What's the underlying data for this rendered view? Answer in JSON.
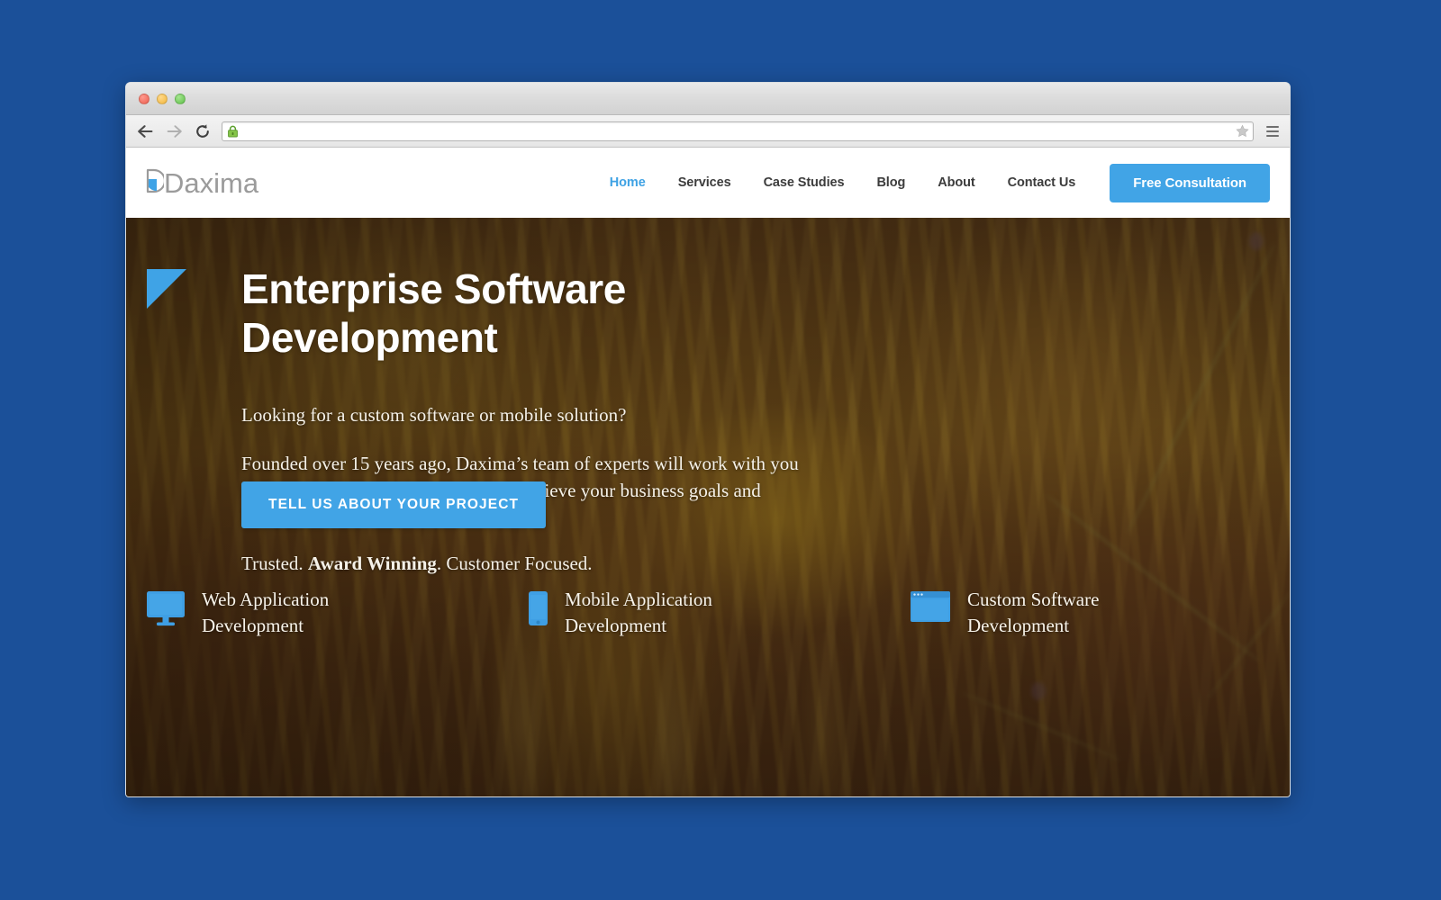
{
  "desktop": {
    "background_color": "#1b5099"
  },
  "browser": {
    "window_controls": [
      {
        "name": "close",
        "color": "#ec5f4f"
      },
      {
        "name": "minimize",
        "color": "#f1b63c"
      },
      {
        "name": "zoom",
        "color": "#5fbf4a"
      }
    ],
    "toolbar": {
      "back_icon": "back-arrow-icon",
      "forward_icon": "forward-arrow-icon",
      "reload_icon": "reload-icon",
      "lock_icon": "green-padlock-icon",
      "star_icon": "bookmark-star-icon",
      "menu_icon": "hamburger-menu-icon",
      "address_value": "",
      "address_placeholder": ""
    }
  },
  "site": {
    "logo": {
      "text": "Daxima",
      "mark": "blue-triangle-d-icon",
      "mark_color": "#3fa3e6"
    },
    "nav": [
      {
        "label": "Home",
        "active": true
      },
      {
        "label": "Services",
        "active": false
      },
      {
        "label": "Case Studies",
        "active": false
      },
      {
        "label": "Blog",
        "active": false
      },
      {
        "label": "About",
        "active": false
      },
      {
        "label": "Contact Us",
        "active": false
      }
    ],
    "nav_cta": {
      "label": "Free Consultation",
      "color": "#41a4e6"
    },
    "hero": {
      "accent_icon": "blue-triangle-accent",
      "accent_color": "#3fa3e6",
      "title_line1": "Enterprise Software",
      "title_line2": "Development",
      "lead": "Looking for a custom software or mobile solution?",
      "paragraph": "Founded over 15 years ago, Daxima’s team of experts will work with you to create solutions that can help you achieve your business goals and bring your ideas to life.",
      "tagline_pre": "Trusted. ",
      "tagline_bold": "Award Winning",
      "tagline_post": ". Customer Focused.",
      "cta_label": "TELL US ABOUT YOUR PROJECT",
      "cta_color": "#41a4e6"
    },
    "services": [
      {
        "icon": "desktop-monitor-icon",
        "line1": "Web Application",
        "line2": "Development",
        "color": "#3f9fe4"
      },
      {
        "icon": "mobile-phone-icon",
        "line1": "Mobile Application",
        "line2": "Development",
        "color": "#3f9fe4"
      },
      {
        "icon": "browser-window-icon",
        "line1": "Custom Software",
        "line2": "Development",
        "color": "#3f9fe4"
      }
    ]
  }
}
